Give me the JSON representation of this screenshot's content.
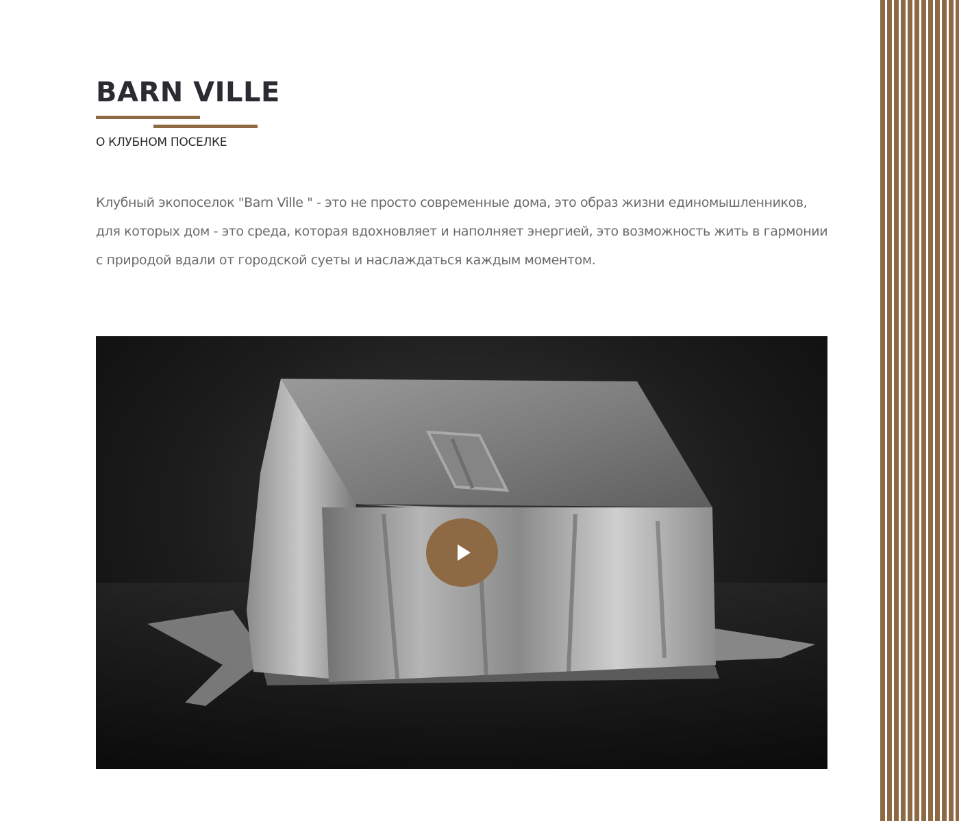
{
  "header": {
    "title": "BARN VILLE",
    "subtitle": "О КЛУБНОМ ПОСЕЛКЕ"
  },
  "description": "Клубный экопоселок \"Barn Ville \" - это не просто современные дома, это образ жизни единомышленников, для которых дом - это среда, которая вдохновляет и наполняет энергией, это возможность жить в гармонии с природой вдали от городской суеты и наслаждаться каждым моментом.",
  "video": {
    "play_icon": "play-icon",
    "preview_subject": "silver cloth draped over a house shape"
  },
  "colors": {
    "accent": "#8e6a44",
    "title": "#2a2c31",
    "body_text": "#6b6b6b",
    "video_background": "#141414"
  }
}
